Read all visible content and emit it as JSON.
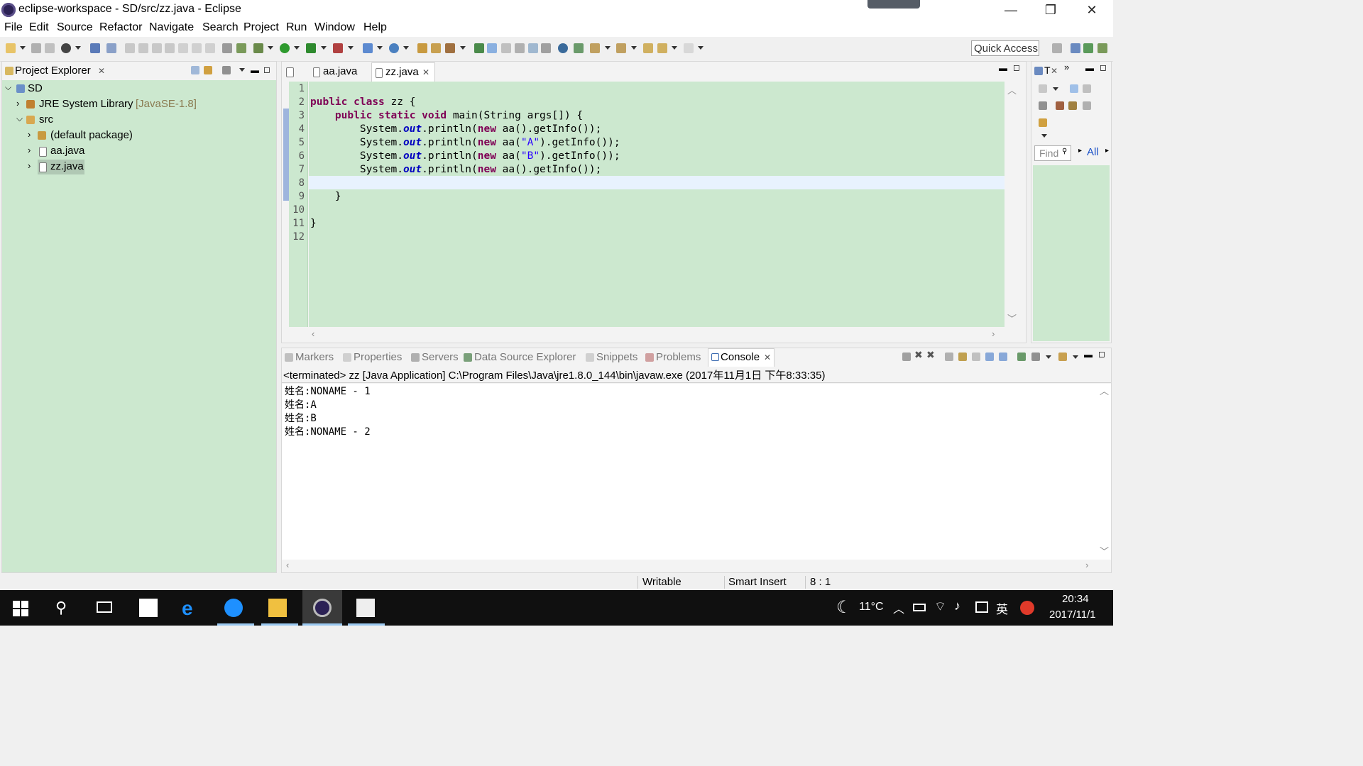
{
  "window": {
    "title": "eclipse-workspace - SD/src/zz.java - Eclipse",
    "minimize": "—",
    "restore": "❐",
    "close": "✕"
  },
  "menu": [
    "File",
    "Edit",
    "Source",
    "Refactor",
    "Navigate",
    "Search",
    "Project",
    "Run",
    "Window",
    "Help"
  ],
  "toolbar": {
    "quick_access": "Quick Access"
  },
  "project_explorer": {
    "title": "Project Explorer",
    "items": [
      {
        "label": "SD",
        "icon": "project-icon"
      },
      {
        "label": "JRE System Library",
        "suffix": "[JavaSE-1.8]",
        "icon": "library-icon"
      },
      {
        "label": "src",
        "icon": "package-folder-icon"
      },
      {
        "label": "(default package)",
        "icon": "package-icon"
      },
      {
        "label": "aa.java",
        "icon": "java-file-icon"
      },
      {
        "label": "zz.java",
        "icon": "java-file-icon"
      }
    ]
  },
  "editor": {
    "tabs": [
      {
        "label": "aa.java",
        "active": false
      },
      {
        "label": "zz.java",
        "active": true
      }
    ],
    "line_numbers": [
      "1",
      "2",
      "3",
      "4",
      "5",
      "6",
      "7",
      "8",
      "9",
      "10",
      "11",
      "12"
    ],
    "lines": [
      "",
      "public class zz {",
      "    public static void main(String args[]) {",
      "        System.out.println(new aa().getInfo());",
      "        System.out.println(new aa(\"A\").getInfo());",
      "        System.out.println(new aa(\"B\").getInfo());",
      "        System.out.println(new aa().getInfo());",
      "",
      "    }",
      "",
      "}",
      ""
    ],
    "current_line": 8
  },
  "outline": {
    "find_placeholder": "Find",
    "all_label": "All"
  },
  "console": {
    "tabs": [
      "Markers",
      "Properties",
      "Servers",
      "Data Source Explorer",
      "Snippets",
      "Problems",
      "Console"
    ],
    "active_tab": "Console",
    "header": "<terminated> zz [Java Application] C:\\Program Files\\Java\\jre1.8.0_144\\bin\\javaw.exe (2017年11月1日 下午8:33:35)",
    "output": [
      "姓名:NONAME - 1",
      "姓名:A",
      "姓名:B",
      "姓名:NONAME - 2"
    ]
  },
  "status": {
    "writable": "Writable",
    "insert_mode": "Smart Insert",
    "position": "8 : 1"
  },
  "taskbar": {
    "weather": "11°C",
    "ime": "英",
    "time": "20:34",
    "date": "2017/11/1"
  },
  "colors": {
    "editor_bg": "#cce8cf",
    "keyword": "#7f0055",
    "field": "#0000c0",
    "string": "#2a00ff",
    "taskbar": "#101010"
  }
}
